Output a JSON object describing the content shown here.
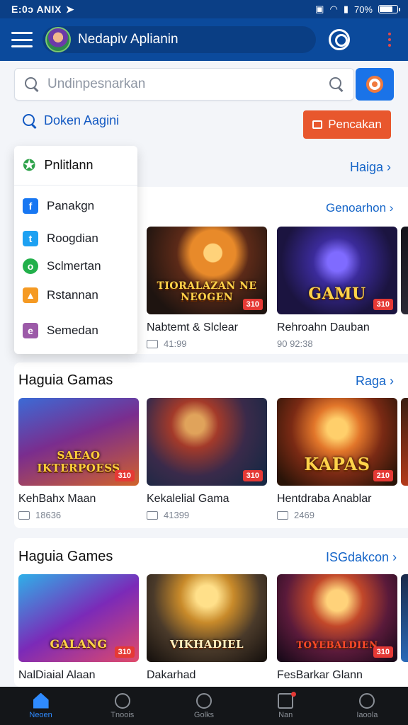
{
  "status_bar": {
    "time": "E:0ↄ ANIX",
    "battery": "70%",
    "battery_level": 0.7
  },
  "app_bar": {
    "title": "Nedapiv Aplianin"
  },
  "search": {
    "placeholder": "Undinpesnarkan"
  },
  "browse_link": "Doken Aagini",
  "cta_button": "Pencakan",
  "dropdown": {
    "header": "Pnlitlann",
    "items": [
      {
        "label": "Panakgn",
        "icon": "facebook-icon",
        "color": "#1877f2",
        "glyph": "f"
      },
      {
        "label": "Roogdian",
        "icon": "twitter-icon",
        "color": "#1da1f2",
        "glyph": "t"
      },
      {
        "label": "Sclmertan",
        "icon": "chat-icon",
        "color": "#22b04b",
        "glyph": "o"
      },
      {
        "label": "Rstannan",
        "icon": "image-icon",
        "color": "#f59a23",
        "glyph": "▲"
      },
      {
        "label": "Semedan",
        "icon": "store-icon",
        "color": "#9c5aa8",
        "glyph": "e"
      }
    ]
  },
  "sections": [
    {
      "title": "",
      "link": "Haiga",
      "sublink": "Genoarhon",
      "cards": [
        {
          "name": "Nabtemt & Slclear",
          "meta": "41:99",
          "price": "310",
          "logo": "TIORALAZAN NE NEOGEN"
        },
        {
          "name": "Rehroahn Dauban",
          "meta": "90 92:38",
          "price": "310",
          "logo": "GAMU"
        }
      ]
    },
    {
      "title": "Haguia Gamas",
      "link": "Raga",
      "cards": [
        {
          "name": "KehBahx Maan",
          "meta": "18636",
          "price": "310",
          "logo": "SAEAO IKTERPOESS"
        },
        {
          "name": "Kekalelial Gama",
          "meta": "41399",
          "price": "310",
          "logo": ""
        },
        {
          "name": "Hentdraba Anablar",
          "meta": "2469",
          "price": "210",
          "logo": "KAPAS"
        }
      ]
    },
    {
      "title": "Haguia Games",
      "link": "ISGdakcon",
      "cards": [
        {
          "name": "NalDiaial Alaan",
          "meta": "",
          "price": "310",
          "logo": "GALANG"
        },
        {
          "name": "Dakarhad",
          "meta": "",
          "price": "",
          "logo": "VIKHADIEL"
        },
        {
          "name": "FesBarkar Glann",
          "meta": "",
          "price": "310",
          "logo": "TOYEBALDIEN"
        }
      ]
    }
  ],
  "bottom_nav": [
    {
      "label": "Neoen",
      "icon": "home-icon"
    },
    {
      "label": "Tnoois",
      "icon": "search-icon"
    },
    {
      "label": "Golks",
      "icon": "compass-icon"
    },
    {
      "label": "Nan",
      "icon": "mail-icon"
    },
    {
      "label": "Iaoola",
      "icon": "profile-icon"
    }
  ]
}
